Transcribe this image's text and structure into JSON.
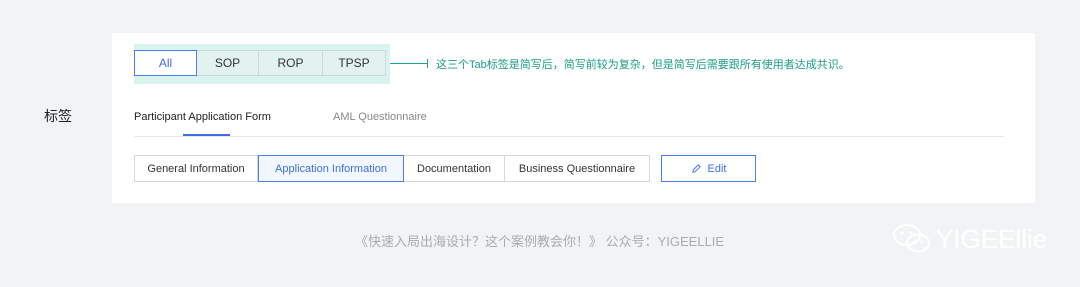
{
  "side_label": "标签",
  "segmented_tabs": [
    "All",
    "SOP",
    "ROP",
    "TPSP"
  ],
  "segmented_active": "All",
  "annotation": "这三个Tab标签是简写后，简写前较为复杂，但是简写后需要跟所有使用者达成共识。",
  "tabs": [
    "Participant Application Form",
    "AML Questionnaire"
  ],
  "active_tab": "Participant Application Form",
  "section_buttons": [
    "General Information",
    "Application Information",
    "Documentation",
    "Business Questionnaire"
  ],
  "active_section": "Application Information",
  "edit_label": "Edit",
  "edit_icon": "pencil-icon",
  "footer_text": "《快速入局出海设计？这个案例教会你！》 公众号：YIGEELLIE",
  "watermark_text": "YIGEEllie",
  "watermark_icon": "wechat-icon",
  "colors": {
    "accent": "#3d6fe0",
    "annotation": "#1a9c86",
    "highlight": "#d9f3ee",
    "background": "#f2f3f5"
  }
}
